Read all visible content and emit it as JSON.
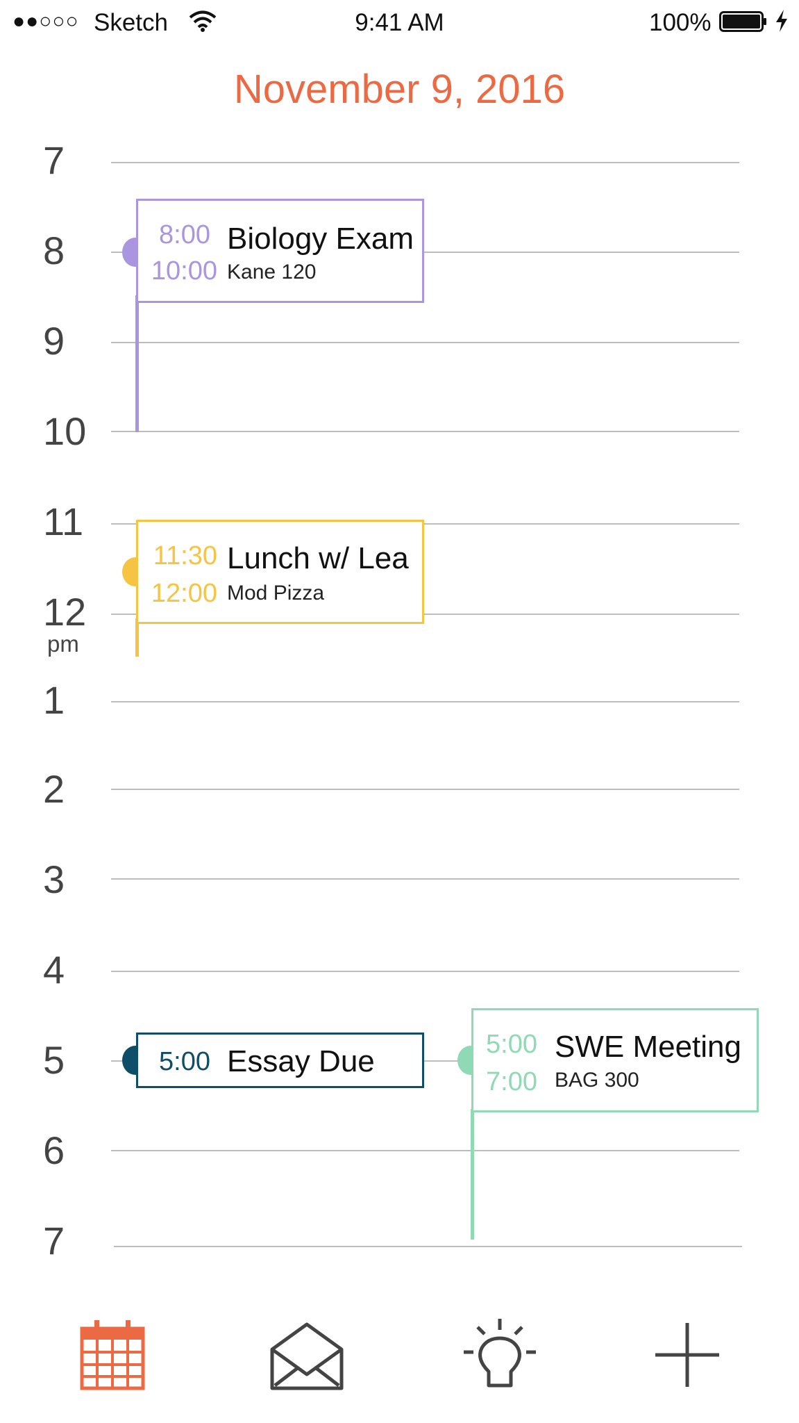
{
  "status_bar": {
    "signal": "●●○○○",
    "carrier": "Sketch",
    "time": "9:41 AM",
    "battery": "100%",
    "icons": [
      "wifi-icon",
      "battery-icon",
      "charging-bolt-icon"
    ]
  },
  "header": {
    "date": "November 9, 2016"
  },
  "timeline": {
    "hours": [
      "7",
      "8",
      "9",
      "10",
      "11",
      "12",
      "1",
      "2",
      "3",
      "4",
      "5",
      "6",
      "7"
    ],
    "pm_marker": "pm"
  },
  "events": [
    {
      "id": "biology",
      "start": "8:00",
      "end": "10:00",
      "title": "Biology Exam",
      "location": "Kane 120",
      "color": "#a995e0"
    },
    {
      "id": "lunch",
      "start": "11:30",
      "end": "12:00",
      "title": "Lunch w/ Lea",
      "location": "Mod Pizza",
      "color": "#f6c443"
    },
    {
      "id": "essay",
      "start": "5:00",
      "title": "Essay Due",
      "color": "#0e4e68"
    },
    {
      "id": "swe",
      "start": "5:00",
      "end": "7:00",
      "title": "SWE Meeting",
      "location": "BAG 300",
      "color": "#8fd9b5"
    }
  ],
  "tab_bar": {
    "tabs": [
      {
        "icon": "calendar-icon",
        "active": true,
        "color": "#ec6a43"
      },
      {
        "icon": "mail-icon",
        "active": false,
        "color": "#444444"
      },
      {
        "icon": "lightbulb-icon",
        "active": false,
        "color": "#444444"
      },
      {
        "icon": "plus-icon",
        "active": false,
        "color": "#444444"
      }
    ]
  },
  "colors": {
    "accent": "#ec6a43",
    "grid": "#bdbdbd"
  }
}
